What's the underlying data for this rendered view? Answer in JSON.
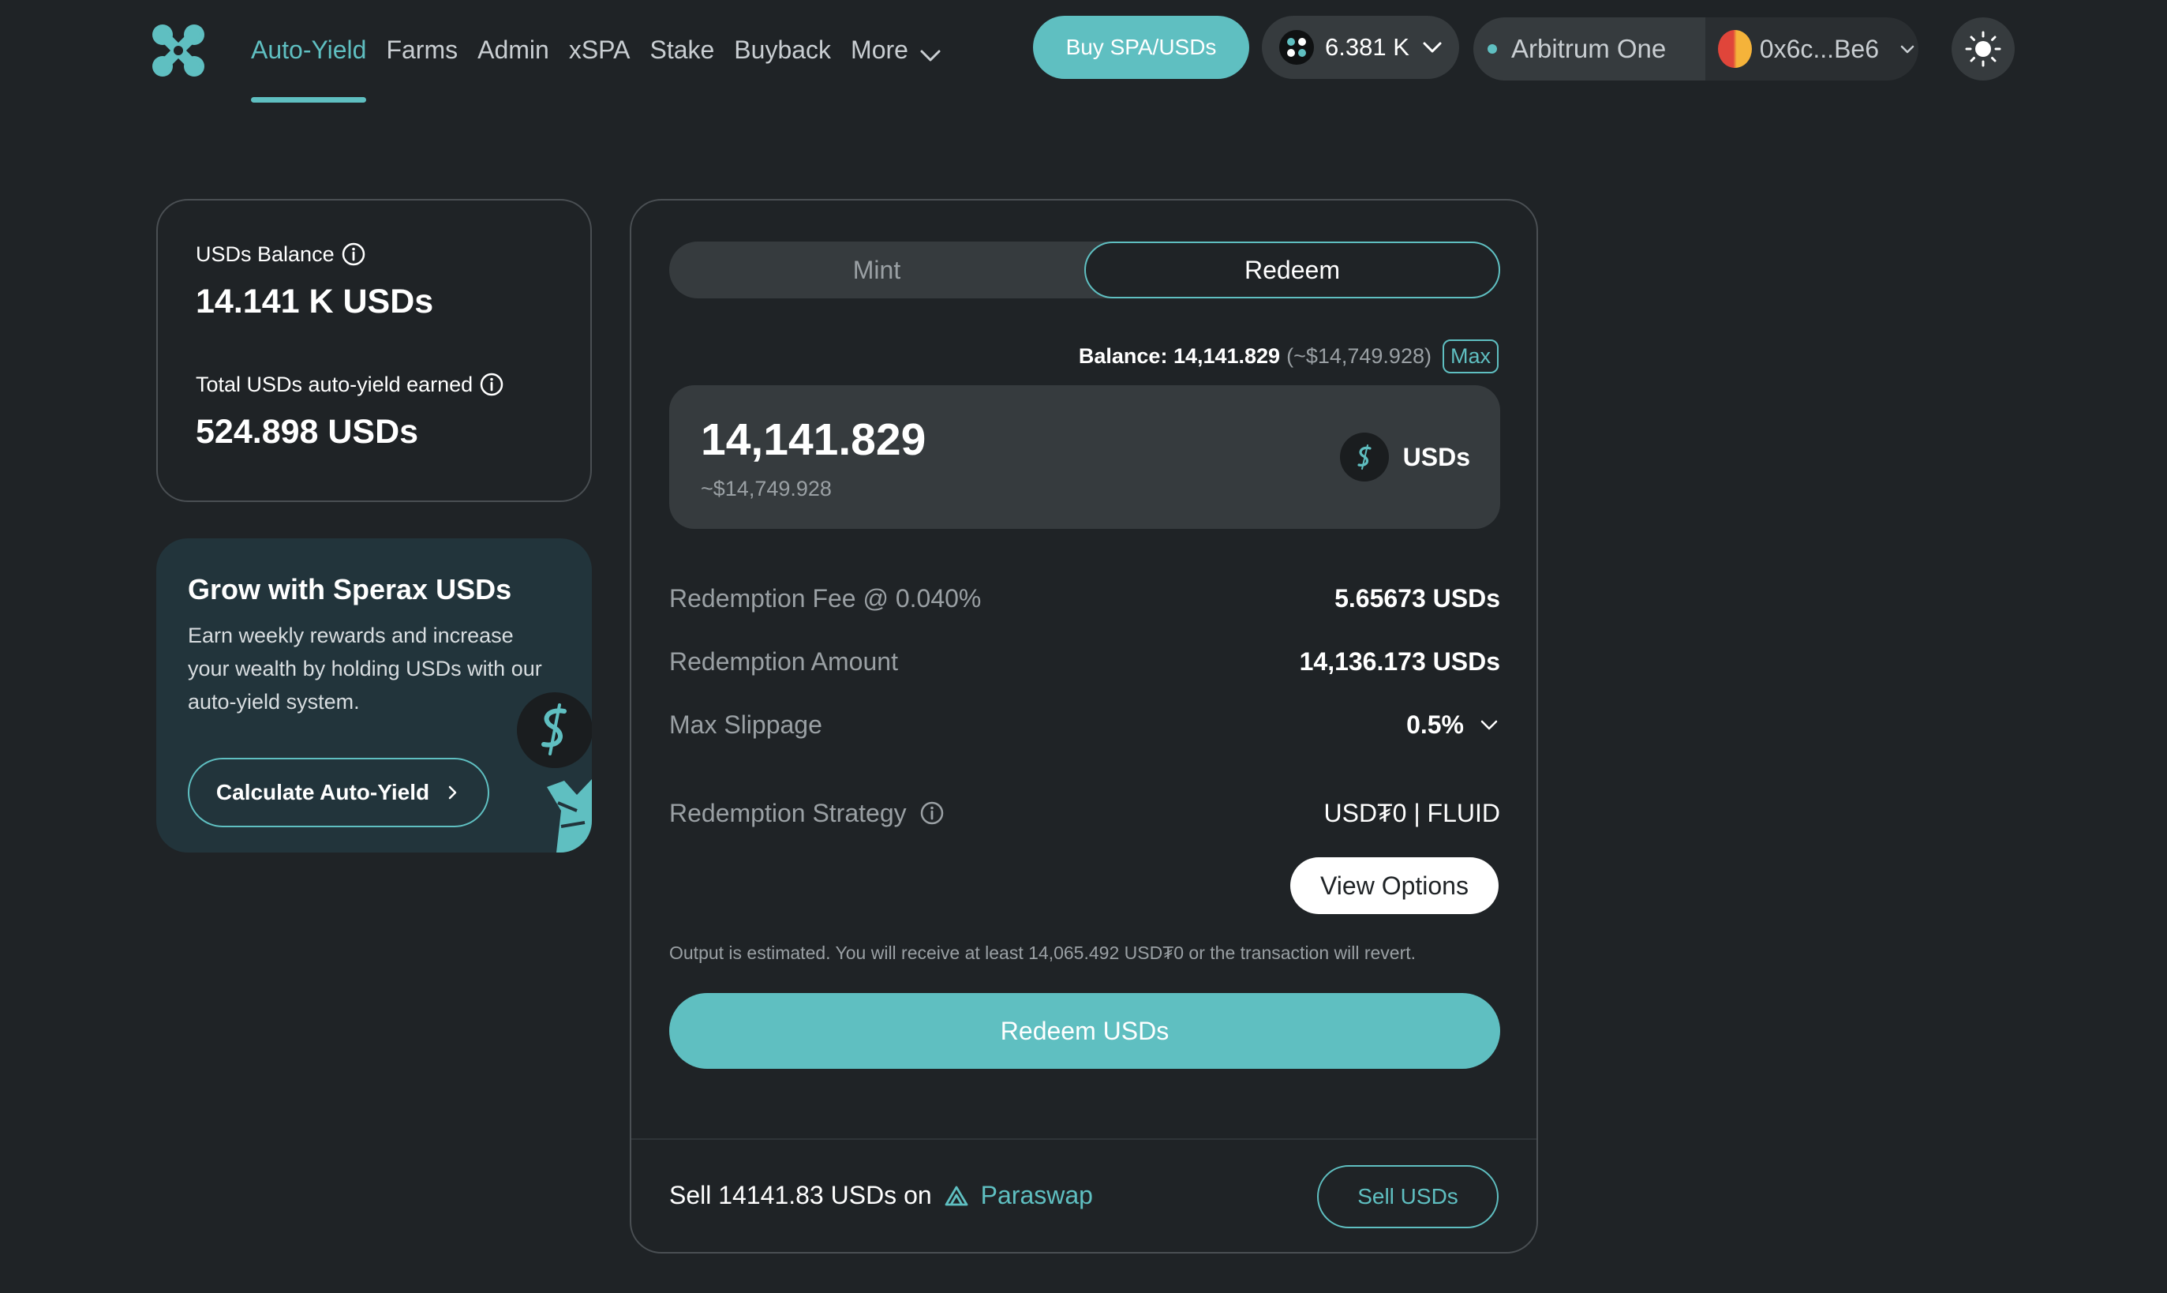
{
  "nav": {
    "links": [
      {
        "label": "Auto-Yield",
        "active": true
      },
      {
        "label": "Farms"
      },
      {
        "label": "Admin"
      },
      {
        "label": "xSPA"
      },
      {
        "label": "Stake"
      },
      {
        "label": "Buyback"
      },
      {
        "label": "More"
      }
    ],
    "buy_button": "Buy SPA/USDs",
    "spa_balance": "6.381 K",
    "network": "Arbitrum One",
    "wallet_address": "0x6c...Be6"
  },
  "balance_card": {
    "balance_label": "USDs Balance",
    "balance_value": "14.141 K USDs",
    "earned_label": "Total USDs auto-yield earned",
    "earned_value": "524.898 USDs"
  },
  "promo": {
    "title": "Grow with Sperax USDs",
    "text": "Earn weekly rewards and increase your wealth by holding USDs with our auto-yield system.",
    "button": "Calculate Auto-Yield"
  },
  "form": {
    "tabs": {
      "mint": "Mint",
      "redeem": "Redeem",
      "selected": "Redeem"
    },
    "balance_label": "Balance: 14,141.829",
    "balance_usd": "(~$14,749.928)",
    "max_label": "Max",
    "amount": "14,141.829",
    "amount_usd": "~$14,749.928",
    "token": "USDs",
    "details": [
      {
        "label": "Redemption Fee @ 0.040%",
        "value": "5.65673 USDs"
      },
      {
        "label": "Redemption Amount",
        "value": "14,136.173 USDs"
      },
      {
        "label": "Max Slippage",
        "value": "0.5%"
      },
      {
        "label": "Redemption Strategy",
        "value": "USD₮0 | FLUID"
      }
    ],
    "view_options": "View Options",
    "estimate_note": "Output is estimated. You will receive at least 14,065.492 USD₮0 or the transaction will revert.",
    "redeem_button": "Redeem USDs",
    "sell_prefix": "Sell 14141.83 USDs on",
    "sell_venue": "Paraswap",
    "sell_button": "Sell USDs"
  },
  "colors": {
    "background": "#1f2326",
    "accent": "#5fbfc1",
    "surface": "#363b3e",
    "promo_bg": "#22343b"
  }
}
